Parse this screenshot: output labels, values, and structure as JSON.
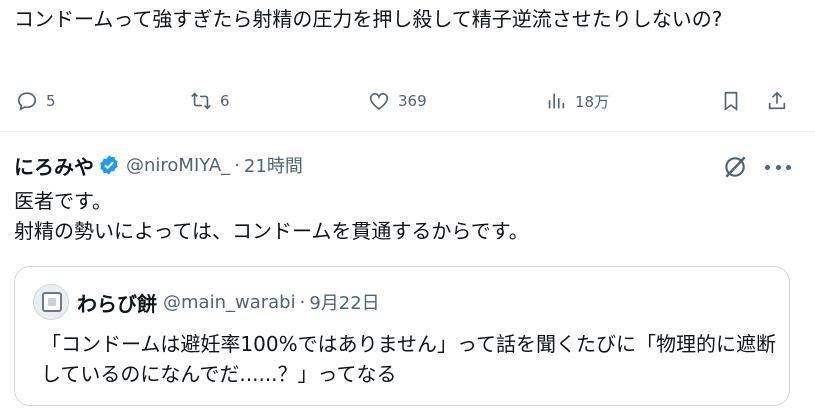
{
  "post": {
    "text": "コンドームって強すぎたら射精の圧力を押し殺して精子逆流させたりしないの?"
  },
  "actions": {
    "reply_count": "5",
    "retweet_count": "6",
    "like_count": "369",
    "views_count": "18万"
  },
  "reply": {
    "name": "にろみや",
    "handle": "@niroMIYA_",
    "separator": "·",
    "time": "21時間",
    "body_line1": "医者です。",
    "body_line2": "射精の勢いによっては、コンドームを貫通するからです。"
  },
  "quote": {
    "name": "わらび餅",
    "handle": "@main_warabi",
    "separator": "·",
    "date": "9月22日",
    "body": "「コンドームは避妊率100%ではありません」って話を聞くたびに「物理的に遮断しているのになんでだ......？」ってなる"
  },
  "colors": {
    "text": "#0f1419",
    "muted": "#536471",
    "verified": "#1d9bf0",
    "border": "#cfd9de"
  }
}
